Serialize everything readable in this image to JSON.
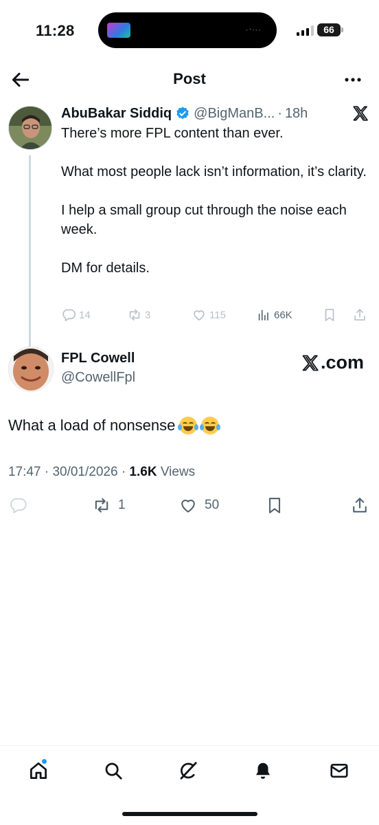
{
  "status_bar": {
    "time": "11:28",
    "battery": "66",
    "signal_bars_active": 3
  },
  "header": {
    "title": "Post",
    "back_icon": "arrow-left-icon",
    "more_icon": "more-horizontal-icon"
  },
  "quoted_post": {
    "author_name": "AbuBakar Siddiq",
    "handle": "@BigManB...",
    "separator": "·",
    "age": "18h",
    "paragraphs": [
      "There’s more FPL content than ever.",
      "What most people lack isn’t information, it’s clarity.",
      "I help a small group cut through the noise each week.",
      "DM for details."
    ],
    "replies": "14",
    "reposts": "3",
    "likes": "115",
    "views": "66K"
  },
  "main_post": {
    "author_name": "FPL Cowell",
    "handle": "@CowellFpl",
    "watermark": ".com",
    "text": "What a load of nonsense",
    "emojis": [
      "face-with-tears-of-joy",
      "face-with-tears-of-joy"
    ],
    "time": "17:47",
    "date": "30/01/2026",
    "separator": "·",
    "views_count": "1.6K",
    "views_label": "Views",
    "reposts": "1",
    "likes": "50"
  },
  "bottom_nav": {
    "items": [
      "home-icon",
      "search-icon",
      "grok-icon",
      "notifications-icon",
      "messages-icon"
    ],
    "home_has_dot": true
  },
  "colors": {
    "text_primary": "#0f1419",
    "text_secondary": "#536471",
    "verified_blue": "#1d9bf0",
    "divider": "#cfd9de",
    "faded_icon": "#b8c0c6"
  }
}
